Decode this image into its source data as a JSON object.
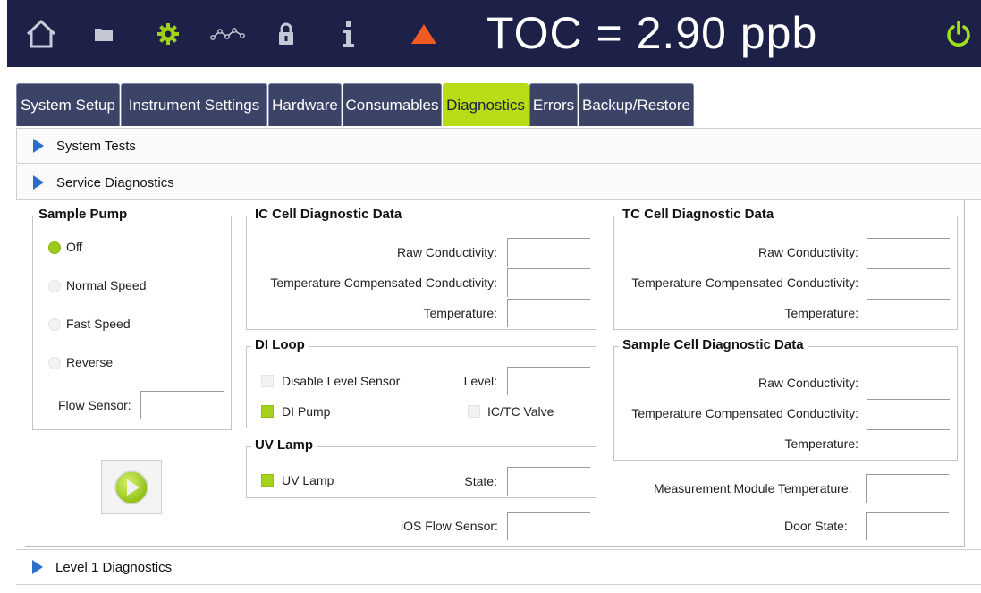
{
  "header": {
    "toc_text": "TOC = 2.90 ppb",
    "icons": [
      "home-icon",
      "folder-icon",
      "gear-icon",
      "trend-icon",
      "lock-icon",
      "info-icon",
      "warning-icon",
      "power-icon"
    ],
    "colors": {
      "bar": "#1d2147",
      "accent_green": "#b8dc15",
      "warning": "#f15a22",
      "power": "#9ee01c"
    }
  },
  "tabs": [
    {
      "label": "System Setup"
    },
    {
      "label": "Instrument Settings"
    },
    {
      "label": "Hardware"
    },
    {
      "label": "Consumables"
    },
    {
      "label": "Diagnostics",
      "active": true
    },
    {
      "label": "Errors"
    },
    {
      "label": "Backup/Restore"
    }
  ],
  "sections": {
    "system_tests": "System Tests",
    "service_diagnostics": "Service Diagnostics",
    "level1": "Level 1 Diagnostics"
  },
  "sample_pump": {
    "title": "Sample Pump",
    "options": [
      {
        "label": "Off",
        "selected": true
      },
      {
        "label": "Normal Speed",
        "selected": false
      },
      {
        "label": "Fast Speed",
        "selected": false
      },
      {
        "label": "Reverse",
        "selected": false
      }
    ],
    "flow_sensor_label": "Flow Sensor:",
    "flow_sensor_value": ""
  },
  "ic_cell": {
    "title": "IC Cell Diagnostic Data",
    "raw_label": "Raw Conductivity:",
    "tcc_label": "Temperature Compensated Conductivity:",
    "temp_label": "Temperature:"
  },
  "tc_cell": {
    "title": "TC Cell Diagnostic Data",
    "raw_label": "Raw Conductivity:",
    "tcc_label": "Temperature Compensated Conductivity:",
    "temp_label": "Temperature:"
  },
  "di_loop": {
    "title": "DI Loop",
    "disable_level_sensor": "Disable Level Sensor",
    "level_label": "Level:",
    "di_pump": "DI Pump",
    "ictc_valve": "IC/TC Valve"
  },
  "sample_cell": {
    "title": "Sample Cell Diagnostic Data",
    "raw_label": "Raw Conductivity:",
    "tcc_label": "Temperature Compensated Conductivity:",
    "temp_label": "Temperature:"
  },
  "uv_lamp": {
    "title": "UV Lamp",
    "uv_lamp_label": "UV Lamp",
    "state_label": "State:"
  },
  "misc": {
    "ios_flow_sensor": "iOS Flow Sensor:",
    "mm_temp": "Measurement Module Temperature:",
    "door_state": "Door State:"
  }
}
